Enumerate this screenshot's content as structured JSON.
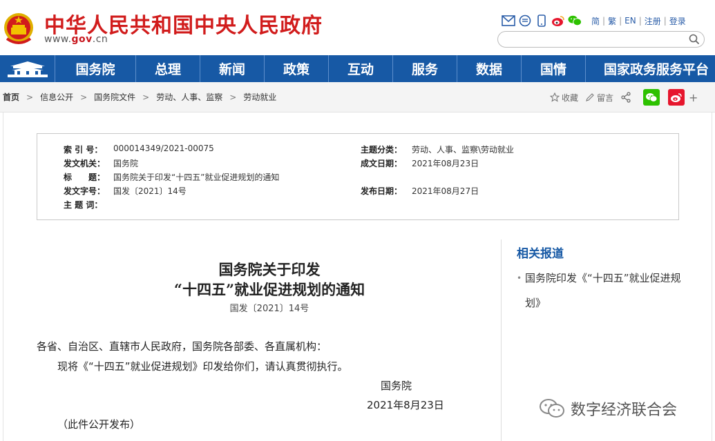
{
  "header": {
    "title": "中华人民共和国中央人民政府",
    "url_prefix": "www.",
    "url_brand": "gov",
    "url_suffix": ".cn",
    "lang_links": [
      "简",
      "繁",
      "EN",
      "注册",
      "登录"
    ],
    "search_placeholder": ""
  },
  "nav": {
    "items": [
      "国务院",
      "总理",
      "新闻",
      "政策",
      "互动",
      "服务",
      "数据",
      "国情",
      "国家政务服务平台"
    ]
  },
  "breadcrumb": [
    "首页",
    "信息公开",
    "国务院文件",
    "劳动、人事、监察",
    "劳动就业"
  ],
  "share": {
    "favorite": "收藏",
    "comment": "留言",
    "plus": "+"
  },
  "meta": {
    "index_label": "索 引 号：",
    "index_value": "000014349/2021-00075",
    "topic_label": "主题分类：",
    "topic_value": "劳动、人事、监察\\劳动就业",
    "issuer_label": "发文机关：",
    "issuer_value": "国务院",
    "date_written_label": "成文日期：",
    "date_written_value": "2021年08月23日",
    "title_label": "标　　题：",
    "title_value": "国务院关于印发“十四五”就业促进规划的通知",
    "doc_no_label": "发文字号：",
    "doc_no_value": "国发〔2021〕14号",
    "publish_label": "发布日期：",
    "publish_value": "2021年08月27日",
    "keywords_label": "主 题 词：",
    "keywords_value": ""
  },
  "article": {
    "title_line1": "国务院关于印发",
    "title_line2": "“十四五”就业促进规划的通知",
    "doc_no": "国发〔2021〕14号",
    "salutation": "各省、自治区、直辖市人民政府，国务院各部委、各直属机构：",
    "body": "现将《“十四五”就业促进规划》印发给你们，请认真贯彻执行。",
    "signature": "国务院",
    "date": "2021年8月23日",
    "note": "（此件公开发布）"
  },
  "related": {
    "title": "相关报道",
    "items": [
      "国务院印发《“十四五”就业促进规划》"
    ]
  },
  "watermark": "数字经济联合会",
  "colors": {
    "brand_red": "#d11c1c",
    "nav_blue": "#1759a5",
    "wechat_green": "#2dc100",
    "weibo_red": "#e6162d"
  }
}
